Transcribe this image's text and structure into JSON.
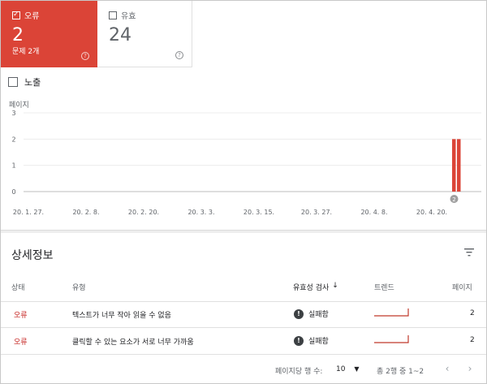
{
  "tiles": {
    "error": {
      "label": "오류",
      "count": "2",
      "sub": "문제 2개"
    },
    "valid": {
      "label": "유효",
      "count": "24"
    }
  },
  "exposure": {
    "label": "노출"
  },
  "chart_data": {
    "type": "bar",
    "ylabel": "페이지",
    "ylim": [
      0,
      3
    ],
    "yticks": [
      0,
      1,
      2,
      3
    ],
    "x_ticks": [
      "20. 1. 27.",
      "20. 2. 8.",
      "20. 2. 20.",
      "20. 3. 3.",
      "20. 3. 15.",
      "20. 3. 27.",
      "20. 4. 8.",
      "20. 4. 20."
    ],
    "series": [
      {
        "color": "#db4437",
        "values": [
          2,
          2
        ]
      }
    ],
    "annotation": "2",
    "grid": true
  },
  "details": {
    "title": "상세정보",
    "columns": {
      "status": "상태",
      "type": "유형",
      "validation": "유효성 검사",
      "trend": "트렌드",
      "pages": "페이지"
    },
    "rows": [
      {
        "status": "오류",
        "type": "텍스트가 너무 작아 읽을 수 없음",
        "validation": "실패함",
        "pages": "2"
      },
      {
        "status": "오류",
        "type": "클릭할 수 있는 요소가 서로 너무 가까움",
        "validation": "실패함",
        "pages": "2"
      }
    ]
  },
  "pagination": {
    "rows_per_page_label": "페이지당 행 수:",
    "rows_per_page": "10",
    "range": "총 2행 중 1~2"
  },
  "colors": {
    "error": "#db4437",
    "status_text": "#c5221f"
  },
  "icons": [
    "checkbox-checked-icon",
    "checkbox-icon",
    "help-icon",
    "filter-icon",
    "sort-down-icon",
    "exclamation-icon",
    "chevron-down-icon",
    "chevron-left-icon",
    "chevron-right-icon"
  ]
}
